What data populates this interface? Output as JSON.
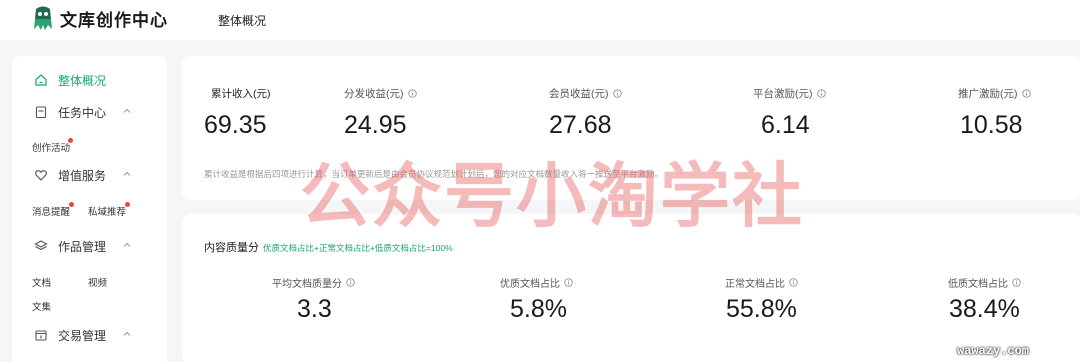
{
  "header": {
    "logo_text": "文库创作中心",
    "nav_label": "整体概况"
  },
  "sidebar": {
    "items": [
      {
        "label": "整体概况",
        "icon": "home-icon",
        "active": true
      },
      {
        "label": "任务中心",
        "icon": "task-icon"
      },
      {
        "label": "增值服务",
        "icon": "heart-icon"
      },
      {
        "label": "作品管理",
        "icon": "layers-icon"
      },
      {
        "label": "交易管理",
        "icon": "transaction-icon"
      }
    ],
    "sub": {
      "create_activity": "创作活动",
      "message_reminder": "消息提醒",
      "private_recommend": "私域推荐",
      "doc": "文档",
      "video": "视频",
      "collection": "文集"
    }
  },
  "income": {
    "metrics": [
      {
        "label": "累计收入(元)",
        "value": "69.35"
      },
      {
        "label": "分发收益(元)",
        "value": "24.95"
      },
      {
        "label": "会员收益(元)",
        "value": "27.68"
      },
      {
        "label": "平台激励(元)",
        "value": "6.14"
      },
      {
        "label": "推广激励(元)",
        "value": "10.58"
      }
    ],
    "note": "累计收益是根据后四项进行计算，当订单更新后是由会员协议规范划计划后，您的对应文档数量收入将一推送至平台激励。"
  },
  "quality": {
    "title": "内容质量分",
    "formula": "优质文档占比+正常文档占比+低质文档占比=100%",
    "metrics": [
      {
        "label": "平均文档质量分",
        "value": "3.3"
      },
      {
        "label": "优质文档占比",
        "value": "5.8%"
      },
      {
        "label": "正常文档占比",
        "value": "55.8%"
      },
      {
        "label": "低质文档占比",
        "value": "38.4%"
      }
    ]
  },
  "watermark": {
    "big": "公众号小淘学社",
    "small": "wawazy.com"
  },
  "colors": {
    "accent": "#19a86b",
    "badge": "#f24040",
    "watermark": "#e65a5a"
  }
}
